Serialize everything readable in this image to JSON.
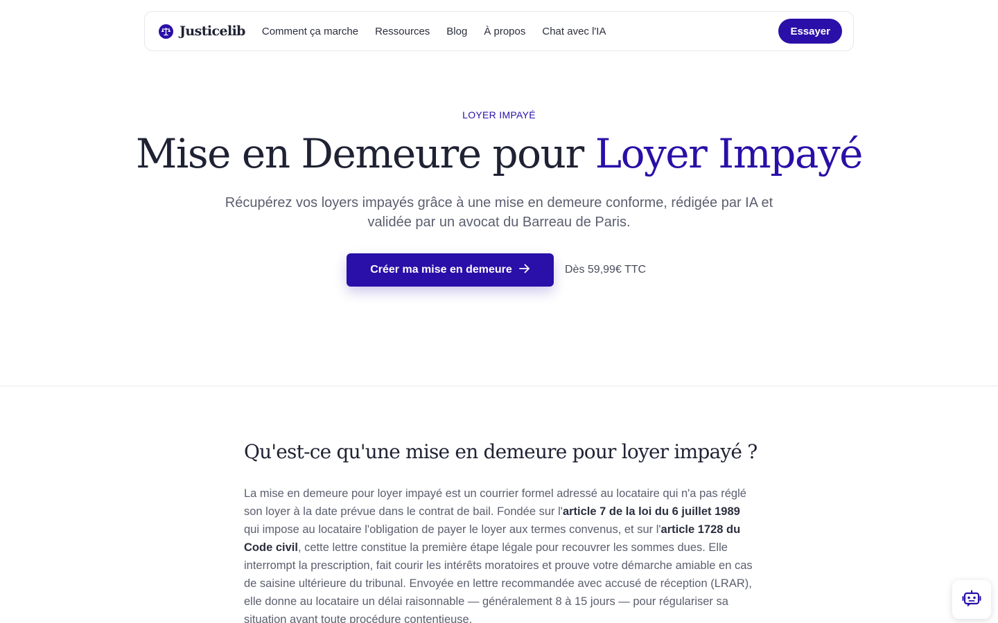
{
  "nav": {
    "brand": "Justicelib",
    "links": [
      "Comment ça marche",
      "Ressources",
      "Blog",
      "À propos",
      "Chat avec l'IA"
    ],
    "cta_label": "Essayer"
  },
  "hero": {
    "eyebrow": "LOYER IMPAYÉ",
    "title_part1": "Mise en Demeure pour ",
    "title_accent": "Loyer Impayé",
    "subtitle": "Récupérez vos loyers impayés grâce à une mise en demeure conforme, rédigée par IA et validée par un avocat du Barreau de Paris.",
    "cta_label": "Créer ma mise en demeure",
    "price_note": "Dès 59,99€ TTC"
  },
  "section": {
    "title": "Qu'est-ce qu'une mise en demeure pour loyer impayé ?",
    "body": {
      "p1": "La mise en demeure pour loyer impayé est un courrier formel adressé au locataire qui n'a pas réglé son loyer à la date prévue dans le contrat de bail. Fondée sur l'",
      "b1": "article 7 de la loi du 6 juillet 1989",
      "p2": " qui impose au locataire l'obligation de payer le loyer aux termes convenus, et sur l'",
      "b2": "article 1728 du Code civil",
      "p3": ", cette lettre constitue la première étape légale pour recouvrer les sommes dues. Elle interrompt la prescription, fait courir les intérêts moratoires et prouve votre démarche amiable en cas de saisine ultérieure du tribunal. Envoyée en lettre recommandée avec accusé de réception (LRAR), elle donne au locataire un délai raisonnable — généralement 8 à 15 jours — pour régulariser sa situation avant toute procédure contentieuse."
    }
  },
  "colors": {
    "brand": "#2a0fa8",
    "text": "#1f2233",
    "muted": "#5b5e6e"
  },
  "icons": {
    "logo": "scales-icon",
    "cta_arrow": "arrow-right-icon",
    "chat": "robot-icon"
  }
}
